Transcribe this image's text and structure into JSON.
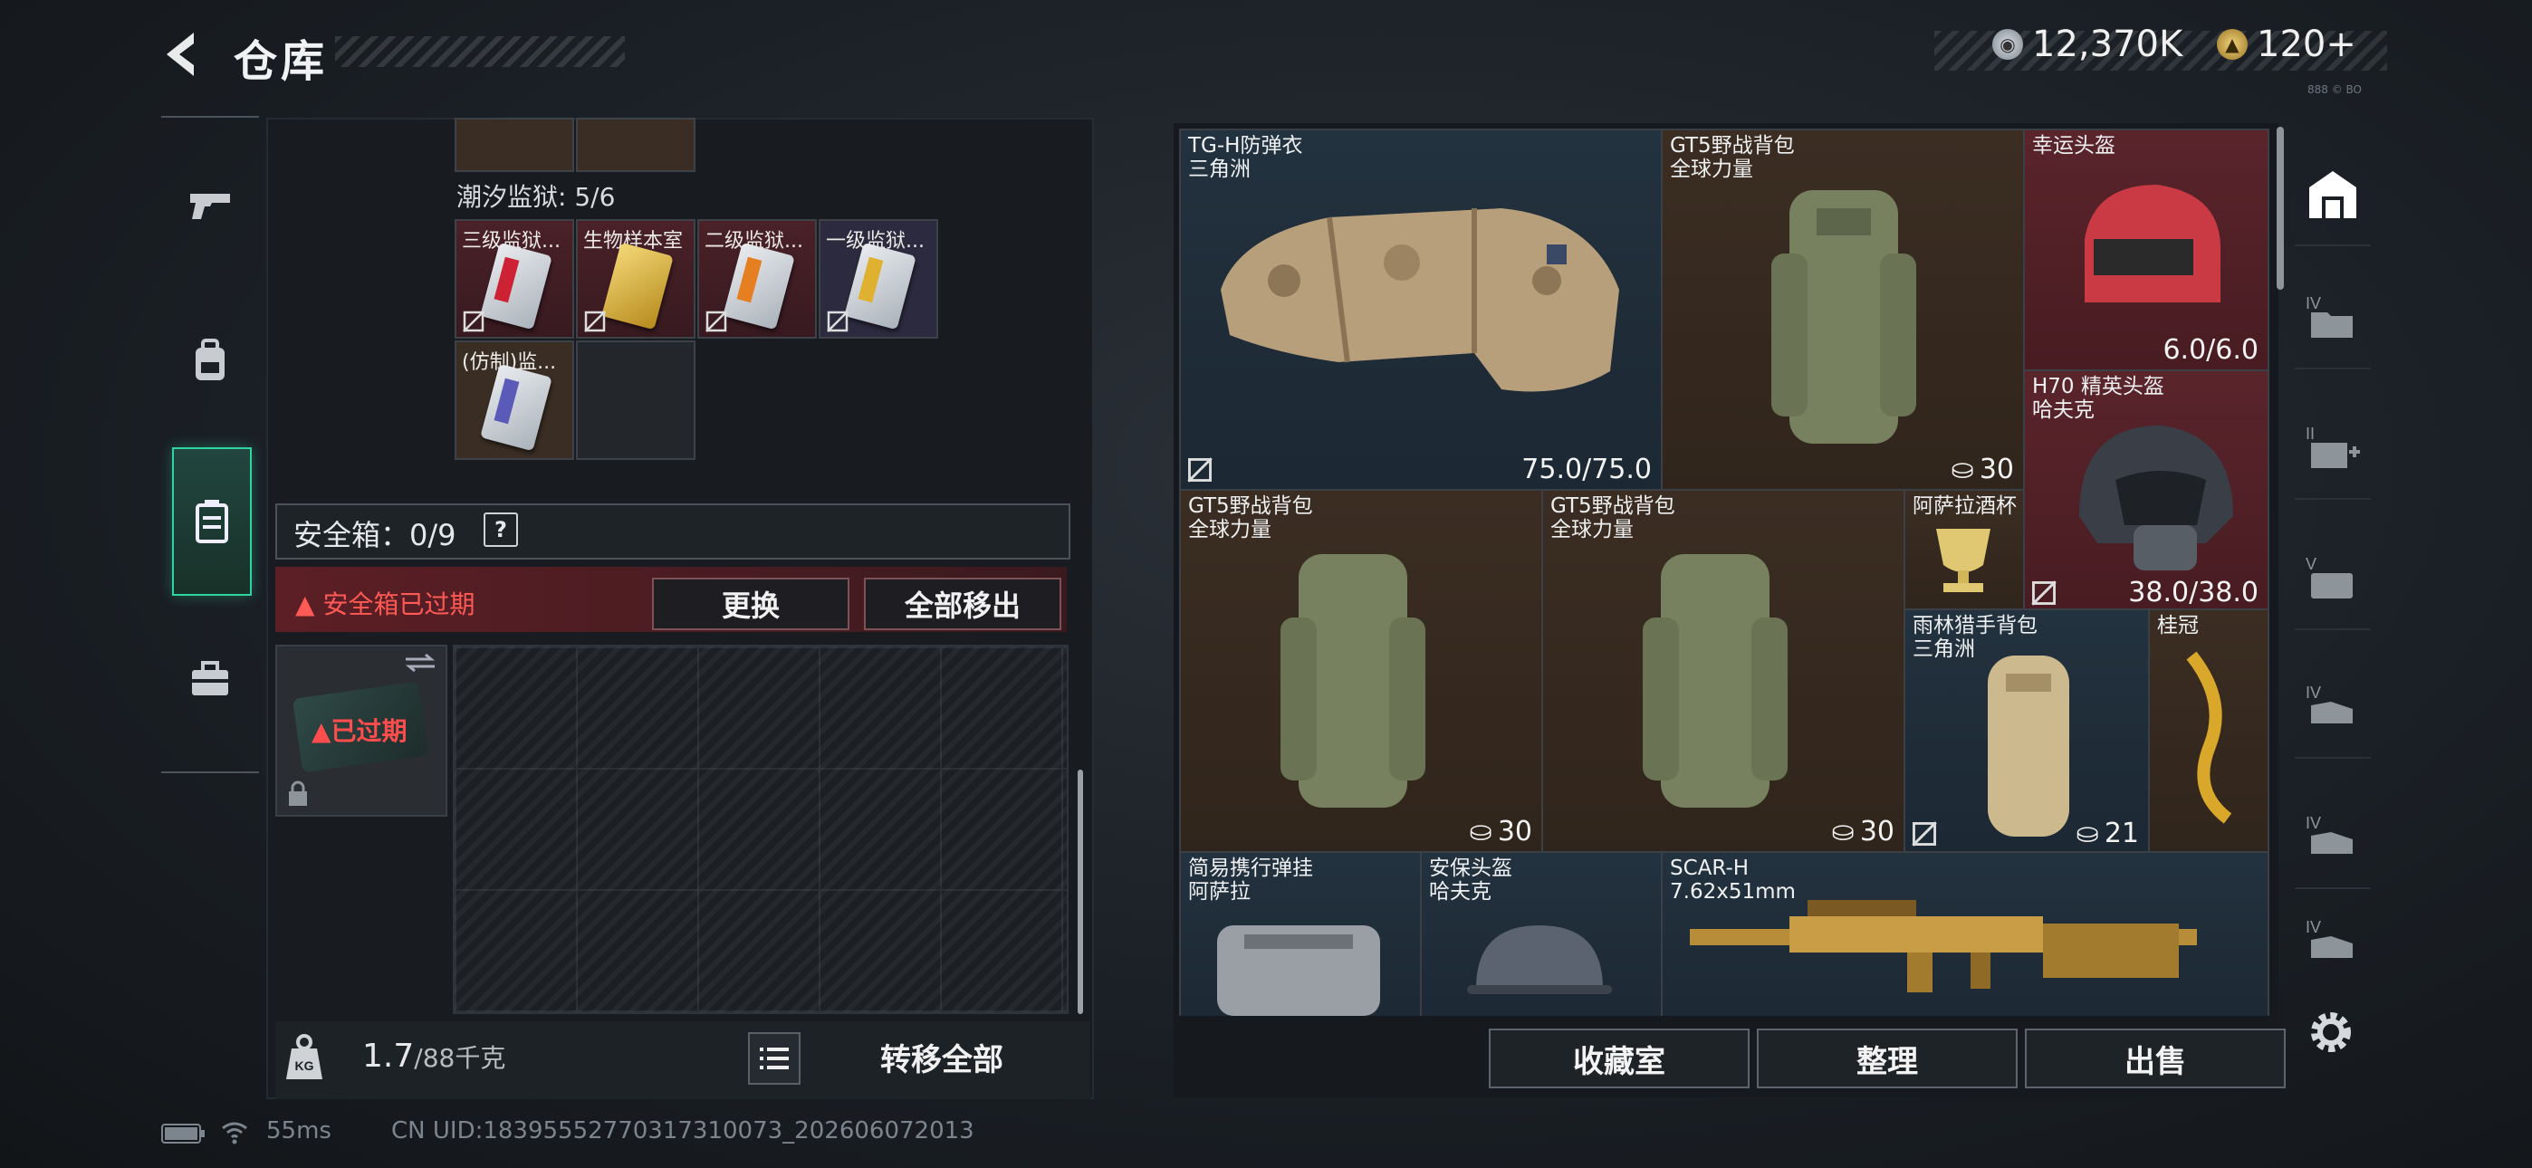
{
  "header": {
    "title": "仓库",
    "currency_silver": "12,370K",
    "currency_gold": "120+",
    "tiny_version": "888 © BO"
  },
  "left_rail": {
    "items": [
      {
        "name": "weapons",
        "icon": "pistol-icon"
      },
      {
        "name": "equipment",
        "icon": "backpack-icon"
      },
      {
        "name": "containers",
        "icon": "case-icon"
      },
      {
        "name": "supplies",
        "icon": "briefcase-icon"
      }
    ]
  },
  "keys_section": {
    "label": "潮汐监狱: 5/6",
    "cards": [
      {
        "label": "三级监狱..."
      },
      {
        "label": "生物样本室"
      },
      {
        "label": "二级监狱..."
      },
      {
        "label": "一级监狱..."
      },
      {
        "label": "(仿制)监..."
      }
    ]
  },
  "safe_box": {
    "label": "安全箱：0/9",
    "help": "?",
    "expired_message": "安全箱已过期",
    "replace_button": "更换",
    "remove_all_button": "全部移出",
    "case_label": "已过期"
  },
  "weight": {
    "current": "1.7",
    "max": "/88千克",
    "icon_label": "KG",
    "transfer_all": "转移全部"
  },
  "warehouse": {
    "items": [
      {
        "name": "TG-H防弹衣\n三角洲",
        "value": "75.0/75.0"
      },
      {
        "name": "GT5野战背包\n全球力量",
        "capacity": "30"
      },
      {
        "name": "幸运头盔",
        "value": "6.0/6.0"
      },
      {
        "name": "H70 精英头盔\n哈夫克",
        "value": "38.0/38.0"
      },
      {
        "name": "GT5野战背包\n全球力量",
        "capacity": "30"
      },
      {
        "name": "GT5野战背包\n全球力量",
        "capacity": "30"
      },
      {
        "name": "阿萨拉酒杯"
      },
      {
        "name": "雨林猎手背包\n三角洲",
        "capacity": "21"
      },
      {
        "name": "桂冠"
      },
      {
        "name": "简易携行弹挂\n阿萨拉"
      },
      {
        "name": "安保头盔\n哈夫克"
      },
      {
        "name": "SCAR-H\n7.62x51mm"
      }
    ],
    "buttons": {
      "collection": "收藏室",
      "sort": "整理",
      "sell": "出售"
    }
  },
  "right_rail": {
    "tiers": [
      "IV",
      "II",
      "V",
      "IV",
      "IV",
      "IV"
    ]
  },
  "status_bar": {
    "ping": "55ms",
    "uid": "CN UID:18395552770317310073_202606072013"
  },
  "colors": {
    "accent_green": "#2fd4a0",
    "expired_red": "#ff5a55",
    "cell_red": "#5a242b",
    "cell_blue": "#23323f",
    "cell_brown": "#3b2d22"
  }
}
